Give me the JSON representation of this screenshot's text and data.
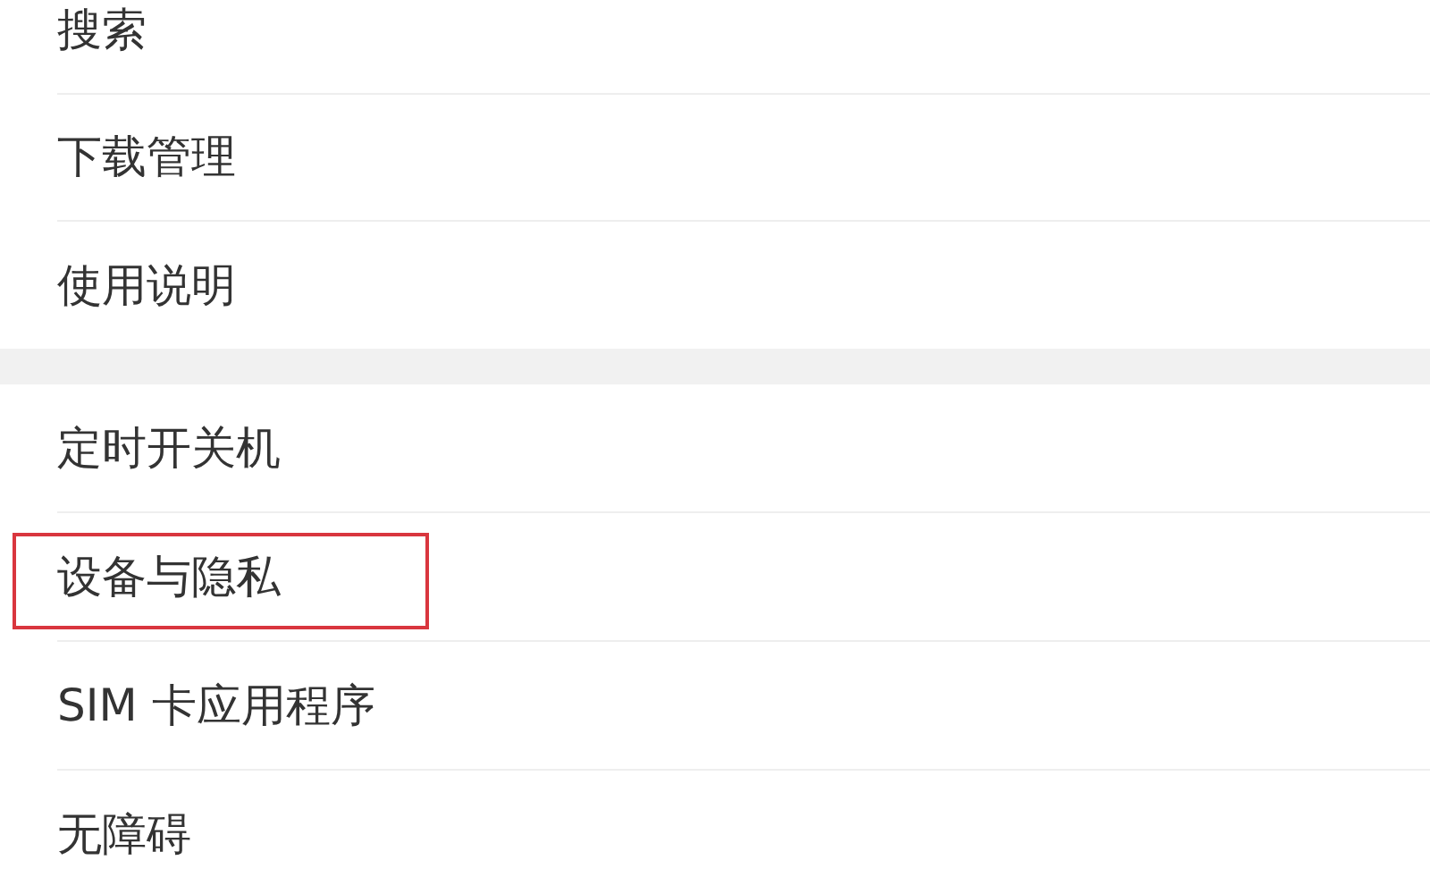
{
  "sections": [
    {
      "items": [
        {
          "label": "搜索",
          "highlighted": false
        },
        {
          "label": "下载管理",
          "highlighted": false
        },
        {
          "label": "使用说明",
          "highlighted": false
        }
      ]
    },
    {
      "items": [
        {
          "label": "定时开关机",
          "highlighted": false
        },
        {
          "label": "设备与隐私",
          "highlighted": true
        },
        {
          "label": "SIM 卡应用程序",
          "highlighted": false
        },
        {
          "label": "无障碍",
          "highlighted": false
        }
      ]
    }
  ]
}
